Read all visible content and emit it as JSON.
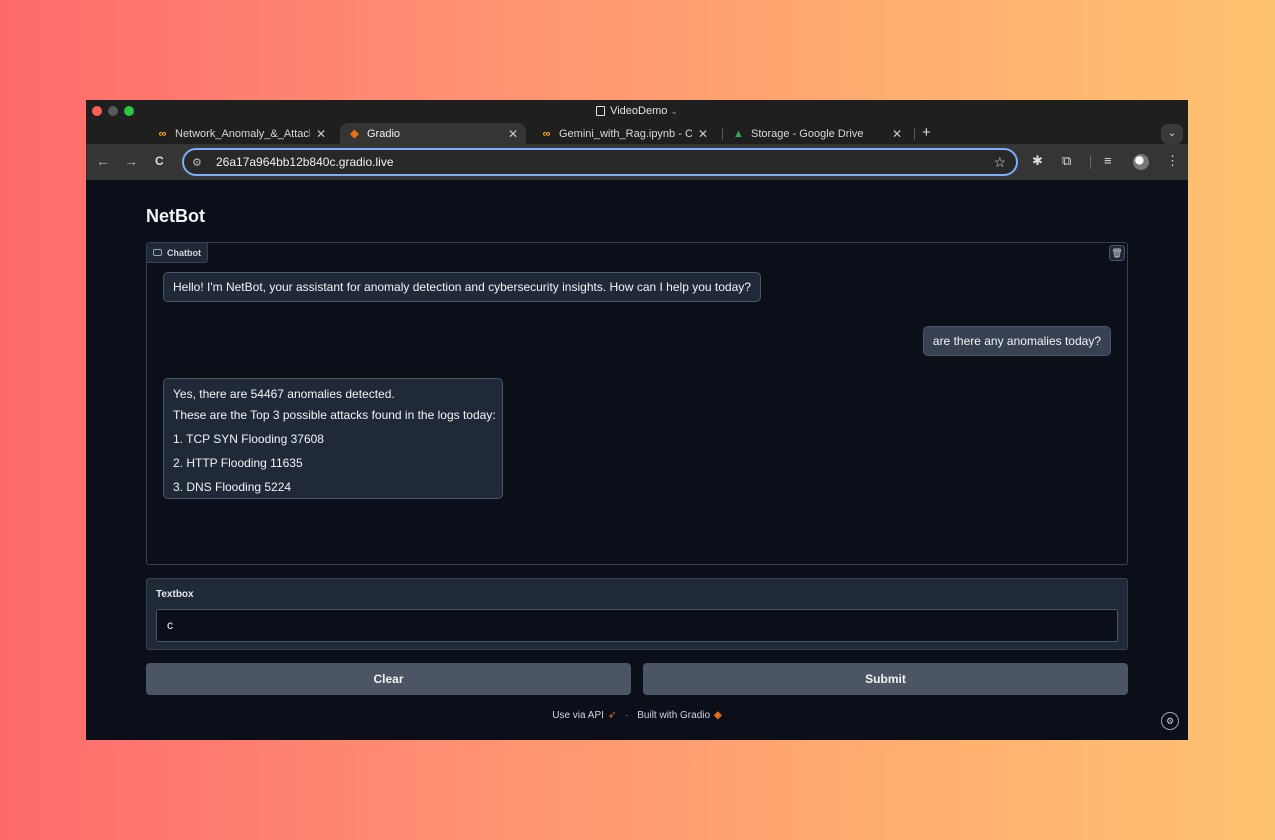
{
  "window": {
    "title": "VideoDemo",
    "title_chevron": "⌄"
  },
  "tabs": [
    {
      "label": "Network_Anomaly_&_Attack_",
      "icon": "colab-icon",
      "icon_glyph": "∞",
      "active": false
    },
    {
      "label": "Gradio",
      "icon": "gradio-icon",
      "icon_glyph": "◈",
      "active": true
    },
    {
      "label": "Gemini_with_Rag.ipynb - Col",
      "icon": "colab-icon",
      "icon_glyph": "∞",
      "active": false
    },
    {
      "label": "Storage - Google Drive",
      "icon": "drive-icon",
      "icon_glyph": "▲",
      "active": false
    }
  ],
  "tab_close": "✕",
  "new_tab": "+",
  "tab_search": "⌄",
  "toolbar": {
    "back": "←",
    "forward": "→",
    "reload": "C",
    "site_info": "⚙",
    "url": "26a17a964bb12b840c.gradio.live",
    "star": "☆",
    "extensions_icon": "✱",
    "puzzle_icon": "⧉",
    "reading_icon": "≡",
    "menu": "⋮"
  },
  "app": {
    "title": "NetBot",
    "chatbot_label": "Chatbot",
    "trash_glyph": "🗑",
    "messages": [
      {
        "role": "bot",
        "lines": [
          "Hello! I'm NetBot, your assistant for anomaly detection and cybersecurity insights. How can I help you today?"
        ]
      },
      {
        "role": "user",
        "lines": [
          "are there any anomalies today?"
        ]
      },
      {
        "role": "bot",
        "lines": [
          "Yes, there are 54467 anomalies detected.",
          "These are the Top 3 possible attacks found in the logs today:",
          "1. TCP SYN Flooding 37608",
          "2. HTTP Flooding 11635",
          "3. DNS Flooding 5224"
        ]
      }
    ],
    "textbox_label": "Textbox",
    "textbox_value": "c",
    "clear_label": "Clear",
    "submit_label": "Submit",
    "footer": {
      "api_label": "Use via API",
      "separator": "·",
      "built_label": "Built with Gradio"
    }
  },
  "colors": {
    "accent_focus": "#7cacf8",
    "brand_orange": "#f97316",
    "app_bg": "#0b0f19"
  }
}
